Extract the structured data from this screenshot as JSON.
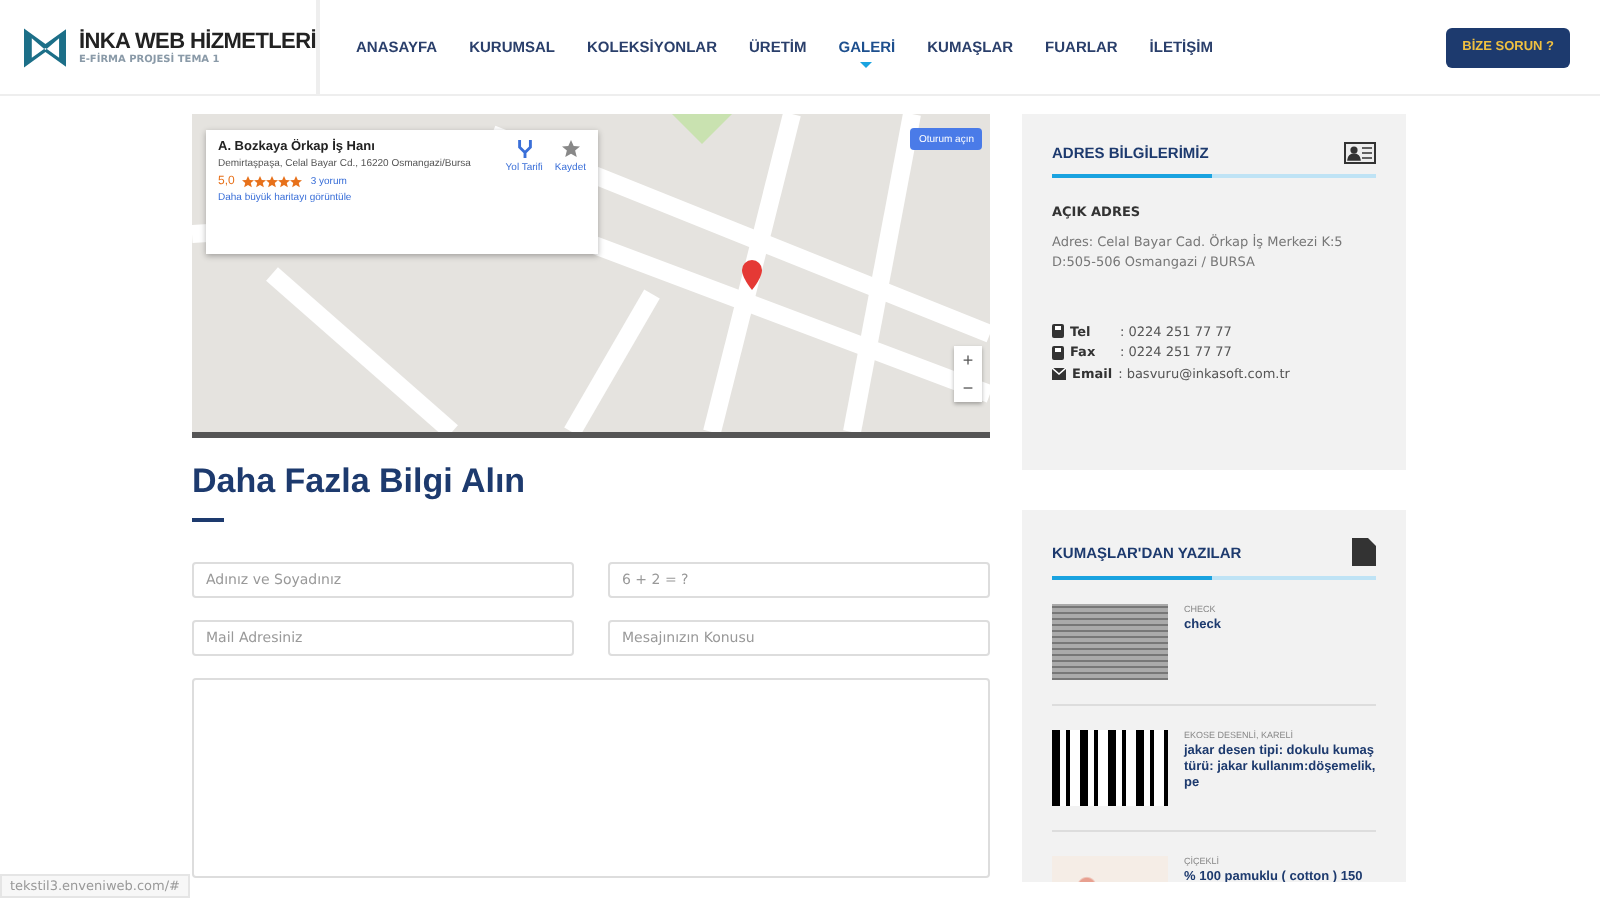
{
  "header": {
    "logo": {
      "title": "İNKA WEB HİZMETLERİ",
      "subtitle": "E-FİRMA PROJESİ TEMA 1"
    },
    "nav": [
      {
        "label": "ANASAYFA",
        "selected": false
      },
      {
        "label": "KURUMSAL",
        "selected": false
      },
      {
        "label": "KOLEKSİYONLAR",
        "selected": false
      },
      {
        "label": "ÜRETİM",
        "selected": false
      },
      {
        "label": "GALERİ",
        "selected": true
      },
      {
        "label": "KUMAŞLAR",
        "selected": false
      },
      {
        "label": "FUARLAR",
        "selected": false
      },
      {
        "label": "İLETİŞİM",
        "selected": false
      }
    ],
    "cta": "BİZE SORUN ?"
  },
  "map": {
    "place_card": {
      "name": "A. Bozkaya Örkap İş Hanı",
      "address": "Demirtaşpaşa, Celal Bayar Cd., 16220 Osmangazi/Bursa",
      "rating": "5,0",
      "stars": 5,
      "reviews": "3 yorum",
      "directions": "Yol Tarifi",
      "save": "Kaydet",
      "larger_map": "Daha büyük haritayı görüntüle"
    },
    "sign_in": "Oturum açın",
    "zoom_in": "+",
    "zoom_out": "−"
  },
  "form": {
    "title": "Daha Fazla Bilgi Alın",
    "fields": [
      {
        "placeholder": "Adınız ve Soyadınız"
      },
      {
        "placeholder": "6 + 2 = ?"
      },
      {
        "placeholder": "Mail Adresiniz"
      },
      {
        "placeholder": "Mesajınızın Konusu"
      }
    ]
  },
  "address_card": {
    "title": "ADRES BİLGİLERİMİZ",
    "subtitle": "AÇIK ADRES",
    "address": "Adres: Celal Bayar Cad. Örkap İş Merkezi K:5 D:505-506 Osmangazi / BURSA",
    "contacts": [
      {
        "kind": "phone",
        "label": "Tel",
        "value": ": 0224 251 77 77"
      },
      {
        "kind": "phone",
        "label": "Fax",
        "value": ": 0224 251 77 77"
      },
      {
        "kind": "mail",
        "label": "Email",
        "value": ": basvuru@inkasoft.com.tr"
      }
    ]
  },
  "posts_card": {
    "title": "KUMAŞLAR'DAN YAZILAR",
    "posts": [
      {
        "kind": "stripe",
        "category": "CHECK",
        "title": "check"
      },
      {
        "kind": "plaid",
        "category": "EKOSE DESENLİ, KARELİ",
        "title": " jakar desen tipi: dokulu kumaş türü: jakar kullanım:döşemelik, pe"
      },
      {
        "kind": "floral",
        "category": "ÇİÇEKLİ",
        "title": "% 100 pamuklu ( cotton ) 150"
      }
    ]
  },
  "status_url": "tekstil3.enveniweb.com/#"
}
